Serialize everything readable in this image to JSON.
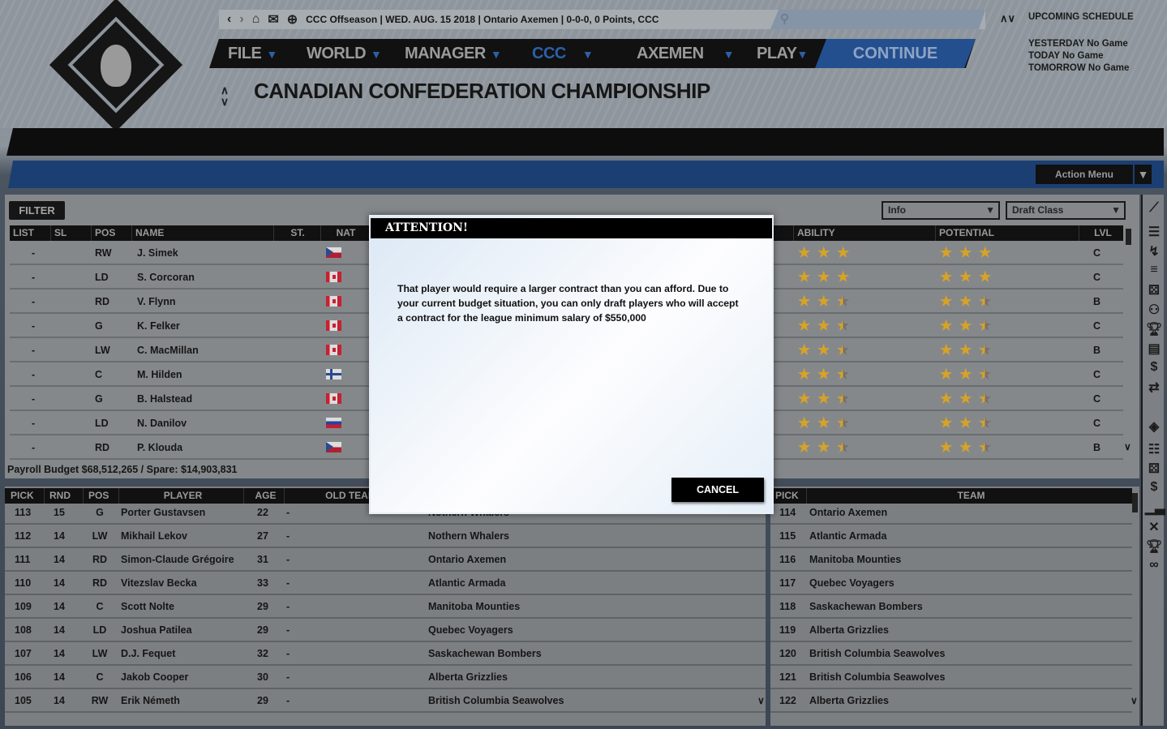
{
  "topbar": {
    "status": "CCC Offseason | WED. AUG. 15 2018 | Ontario Axemen | 0-0-0, 0 Points, CCC",
    "search_placeholder": ""
  },
  "nav": {
    "items": [
      {
        "label": "FILE"
      },
      {
        "label": "WORLD"
      },
      {
        "label": "MANAGER"
      },
      {
        "label": "CCC",
        "active": true
      },
      {
        "label": "AXEMEN"
      },
      {
        "label": "PLAY"
      }
    ],
    "continue": "CONTINUE",
    "accent": "#2e5fa8"
  },
  "page_title": "CANADIAN CONFEDERATION CHAMPIONSHIP",
  "schedule": {
    "title": "UPCOMING SCHEDULE",
    "yesterday": "YESTERDAY No Game",
    "today": "TODAY No Game",
    "tomorrow": "TOMORROW No Game"
  },
  "action_menu": "Action Menu",
  "filter": "FILTER",
  "dropdowns": {
    "view": "Info",
    "source": "Draft Class"
  },
  "players_table": {
    "headers": {
      "list": "LIST",
      "sl": "SL",
      "pos": "POS",
      "name": "NAME",
      "st": "ST.",
      "nat": "NAT",
      "ability": "ABILITY",
      "potential": "POTENTIAL",
      "lvl": "LVL"
    },
    "rows": [
      {
        "list": "-",
        "pos": "RW",
        "name": "J. Simek",
        "nat": "cz",
        "ability": 3,
        "potential": 3,
        "lvl": "C"
      },
      {
        "list": "-",
        "pos": "LD",
        "name": "S. Corcoran",
        "nat": "ca",
        "ability": 3,
        "potential": 3,
        "lvl": "C"
      },
      {
        "list": "-",
        "pos": "RD",
        "name": "V. Flynn",
        "nat": "ca",
        "ability": 2.5,
        "potential": 2.5,
        "lvl": "B"
      },
      {
        "list": "-",
        "pos": "G",
        "name": "K. Felker",
        "nat": "ca",
        "ability": 2.5,
        "potential": 2.5,
        "lvl": "C"
      },
      {
        "list": "-",
        "pos": "LW",
        "name": "C. MacMillan",
        "nat": "ca",
        "ability": 2.5,
        "potential": 2.5,
        "lvl": "B"
      },
      {
        "list": "-",
        "pos": "C",
        "name": "M. Hilden",
        "nat": "fi",
        "ability": 2.5,
        "potential": 2.5,
        "lvl": "C"
      },
      {
        "list": "-",
        "pos": "G",
        "name": "B. Halstead",
        "nat": "ca",
        "ability": 2.5,
        "potential": 2.5,
        "lvl": "C"
      },
      {
        "list": "-",
        "pos": "LD",
        "name": "N. Danilov",
        "nat": "ru",
        "ability": 2.5,
        "potential": 2.5,
        "lvl": "C"
      },
      {
        "list": "-",
        "pos": "RD",
        "name": "P. Klouda",
        "nat": "cz",
        "ability": 2.5,
        "potential": 2.5,
        "lvl": "B"
      }
    ]
  },
  "payroll": "Payroll Budget $68,512,265 / Spare: $14,903,831",
  "picks_table": {
    "headers": {
      "pick": "PICK",
      "rnd": "RND",
      "pos": "POS",
      "player": "PLAYER",
      "age": "AGE",
      "old_team": "OLD TEAM"
    },
    "rows": [
      {
        "pick": "113",
        "rnd": "15",
        "pos": "G",
        "player": "Porter Gustavsen",
        "age": "22",
        "old": "-",
        "team": "Nothern Whalers"
      },
      {
        "pick": "112",
        "rnd": "14",
        "pos": "LW",
        "player": "Mikhail Lekov",
        "age": "27",
        "old": "-",
        "team": "Nothern Whalers"
      },
      {
        "pick": "111",
        "rnd": "14",
        "pos": "RD",
        "player": "Simon-Claude Grégoire",
        "age": "31",
        "old": "-",
        "team": "Ontario Axemen"
      },
      {
        "pick": "110",
        "rnd": "14",
        "pos": "RD",
        "player": "Vitezslav Becka",
        "age": "33",
        "old": "-",
        "team": "Atlantic Armada"
      },
      {
        "pick": "109",
        "rnd": "14",
        "pos": "C",
        "player": "Scott Nolte",
        "age": "29",
        "old": "-",
        "team": "Manitoba Mounties"
      },
      {
        "pick": "108",
        "rnd": "14",
        "pos": "LD",
        "player": "Joshua Patilea",
        "age": "29",
        "old": "-",
        "team": "Quebec Voyagers"
      },
      {
        "pick": "107",
        "rnd": "14",
        "pos": "LW",
        "player": "D.J. Fequet",
        "age": "32",
        "old": "-",
        "team": "Saskachewan Bombers"
      },
      {
        "pick": "106",
        "rnd": "14",
        "pos": "C",
        "player": "Jakob Cooper",
        "age": "30",
        "old": "-",
        "team": "Alberta Grizzlies"
      },
      {
        "pick": "105",
        "rnd": "14",
        "pos": "RW",
        "player": "Erik Németh",
        "age": "29",
        "old": "-",
        "team": "British Columbia Seawolves"
      }
    ]
  },
  "upcoming_picks": {
    "headers": {
      "pick": "PICK",
      "team": "TEAM"
    },
    "rows": [
      {
        "pick": "114",
        "team": "Ontario Axemen"
      },
      {
        "pick": "115",
        "team": "Atlantic Armada"
      },
      {
        "pick": "116",
        "team": "Manitoba Mounties"
      },
      {
        "pick": "117",
        "team": "Quebec Voyagers"
      },
      {
        "pick": "118",
        "team": "Saskachewan Bombers"
      },
      {
        "pick": "119",
        "team": "Alberta Grizzlies"
      },
      {
        "pick": "120",
        "team": "British Columbia Seawolves"
      },
      {
        "pick": "121",
        "team": "British Columbia Seawolves"
      },
      {
        "pick": "122",
        "team": "Alberta Grizzlies"
      }
    ]
  },
  "sidebar_icons": [
    "hockey-stick-icon",
    "clipboard-icon",
    "tactics-icon",
    "lines-icon",
    "dice-icon",
    "players-icon",
    "trophy-icon",
    "report-icon",
    "contract-icon",
    "trade-icon",
    "league-logo-icon",
    "list-icon",
    "dice-icon",
    "dollar-icon",
    "stats-icon",
    "sticks-icon",
    "trophy-icon",
    "scout-binoculars-icon"
  ],
  "dialog": {
    "title": "ATTENTION!",
    "message": "That player would require a larger contract than you can afford. Due to your current budget situation, you can only draft players who will accept a contract for the league minimum salary of $550,000",
    "cancel": "CANCEL"
  }
}
